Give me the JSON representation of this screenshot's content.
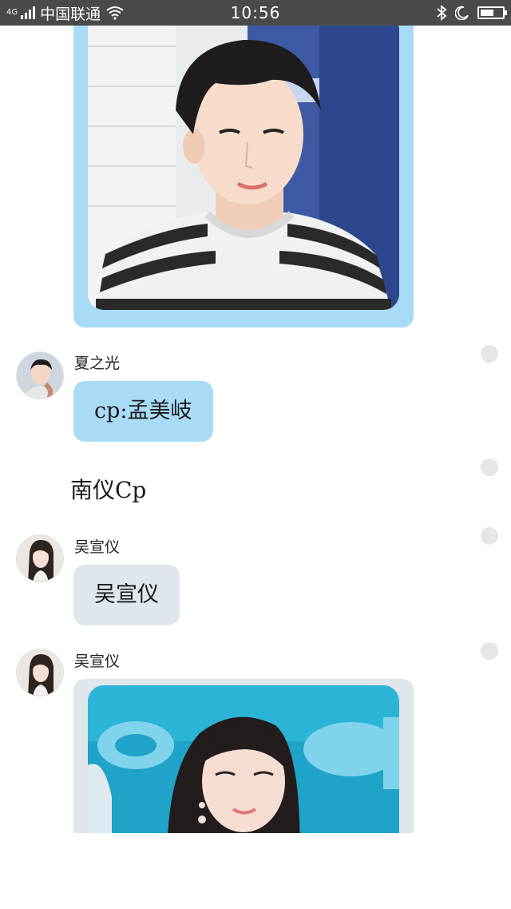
{
  "status_bar": {
    "network": "4G",
    "carrier": "中国联通",
    "time": "10:56",
    "icons": [
      "signal-icon",
      "wifi-icon",
      "bluetooth-icon",
      "moon-icon",
      "battery-icon"
    ],
    "battery_level": 0.6
  },
  "messages": [
    {
      "type": "image",
      "description_icon": "photo-man-striped-shirt",
      "bubble_color": "#a8dcf6"
    },
    {
      "type": "text",
      "sender": "夏之光",
      "text": "cp:孟美岐",
      "bubble_color": "#a8dcf6"
    },
    {
      "type": "plain",
      "text": "南仪Cp"
    },
    {
      "type": "text",
      "sender": "吴宣仪",
      "text": "吴宣仪",
      "bubble_color": "#dfe6ec"
    },
    {
      "type": "image",
      "sender": "吴宣仪",
      "description_icon": "photo-woman-blue-background",
      "bubble_color": "#dfe6ec"
    }
  ]
}
